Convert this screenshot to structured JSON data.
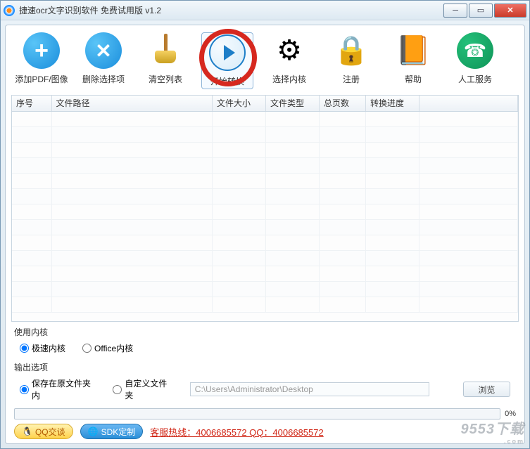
{
  "window": {
    "title": "捷速ocr文字识别软件 免费试用版 v1.2"
  },
  "toolbar": {
    "add": "添加PDF/图像",
    "del": "删除选择项",
    "clear": "清空列表",
    "start": "开始转换",
    "engine": "选择内核",
    "register": "注册",
    "help": "帮助",
    "service": "人工服务"
  },
  "table": {
    "headers": {
      "no": "序号",
      "path": "文件路径",
      "size": "文件大小",
      "type": "文件类型",
      "pages": "总页数",
      "progress": "转换进度"
    }
  },
  "engineSection": {
    "title": "使用内核",
    "fast": "极速内核",
    "office": "Office内核",
    "selected": "fast"
  },
  "outputSection": {
    "title": "输出选项",
    "same": "保存在原文件夹内",
    "custom": "自定义文件夹",
    "selected": "same",
    "path": "C:\\Users\\Administrator\\Desktop",
    "browse": "浏览"
  },
  "progress": {
    "pct": "0%"
  },
  "footer": {
    "qq": "QQ交谈",
    "sdk": "SDK定制",
    "hotline": "客服热线：4006685572 QQ：4006685572"
  },
  "watermark": "9553下载"
}
